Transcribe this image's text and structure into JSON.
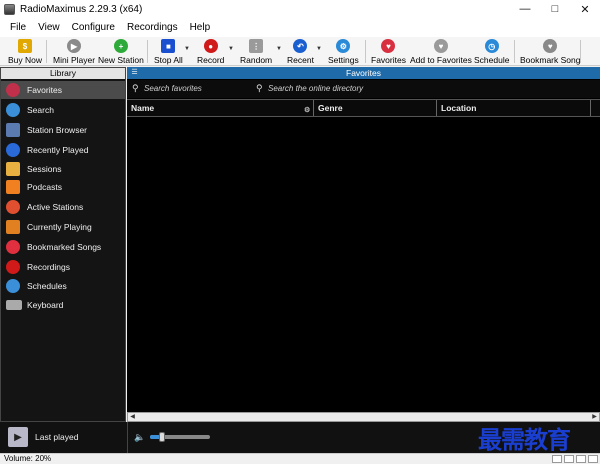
{
  "window": {
    "title": "RadioMaximus 2.29.3 (x64)",
    "controls": [
      "minimize-icon",
      "maximize-icon",
      "close-icon"
    ]
  },
  "menu": [
    "File",
    "View",
    "Configure",
    "Recordings",
    "Help"
  ],
  "toolbar": [
    {
      "id": "buy-now",
      "label": "Buy Now",
      "icon": "buy-now-icon",
      "color": "#e0a800"
    },
    {
      "id": "mini-player",
      "label": "Mini Player",
      "icon": "mini-player-icon",
      "color": "#8a8a8a"
    },
    {
      "id": "new-station",
      "label": "New Station",
      "icon": "plus-icon",
      "color": "#2eaa3a"
    },
    {
      "id": "stop-all",
      "label": "Stop All",
      "icon": "stop-icon",
      "color": "#1a4fd0"
    },
    {
      "id": "record",
      "label": "Record",
      "icon": "record-icon",
      "color": "#d01a1a"
    },
    {
      "id": "random",
      "label": "Random",
      "icon": "dice-icon",
      "color": "#9a9a9a"
    },
    {
      "id": "recent",
      "label": "Recent",
      "icon": "recent-icon",
      "color": "#1a5fd0"
    },
    {
      "id": "settings",
      "label": "Settings",
      "icon": "gear-icon",
      "color": "#2a8ad8"
    },
    {
      "id": "favorites",
      "label": "Favorites",
      "icon": "heart-icon",
      "color": "#d83040"
    },
    {
      "id": "add-to-favorites",
      "label": "Add to Favorites",
      "icon": "heart-add-icon",
      "color": "#9a9a9a"
    },
    {
      "id": "schedule",
      "label": "Schedule",
      "icon": "clock-icon",
      "color": "#2a8ad8"
    },
    {
      "id": "bookmark-song",
      "label": "Bookmark Song",
      "icon": "bookmark-icon",
      "color": "#8a8a8a"
    }
  ],
  "library": {
    "header": "Library",
    "items": [
      {
        "label": "Favorites",
        "icon": "heart-icon",
        "color": "#c0304a",
        "selected": true
      },
      {
        "label": "Search",
        "icon": "search-icon",
        "color": "#3a8fd8"
      },
      {
        "label": "Station Browser",
        "icon": "station-browser-icon",
        "color": "#5a7ab0"
      },
      {
        "label": "Recently Played",
        "icon": "recent-icon",
        "color": "#2a6ad8"
      },
      {
        "label": "Sessions",
        "icon": "folder-icon",
        "color": "#e8b040"
      },
      {
        "label": "Podcasts",
        "icon": "rss-icon",
        "color": "#f08020"
      },
      {
        "label": "Active Stations",
        "icon": "active-stations-icon",
        "color": "#e05030"
      },
      {
        "label": "Currently Playing",
        "icon": "music-note-icon",
        "color": "#e08020"
      },
      {
        "label": "Bookmarked Songs",
        "icon": "heart-icon",
        "color": "#e03040"
      },
      {
        "label": "Recordings",
        "icon": "record-icon",
        "color": "#d01a1a"
      },
      {
        "label": "Schedules",
        "icon": "clock-icon",
        "color": "#3a8fd8"
      },
      {
        "label": "Keyboard",
        "icon": "keyboard-icon",
        "color": "#aaaaaa"
      }
    ]
  },
  "main": {
    "header": "Favorites",
    "search_favorites_placeholder": "Search favorites",
    "search_online_placeholder": "Search the online directory",
    "columns": [
      "Name",
      "Genre",
      "Location"
    ]
  },
  "bottom": {
    "last_played": "Last played"
  },
  "status": {
    "volume": "Volume: 20%",
    "volume_level": 0.2
  },
  "watermark": "最需教育"
}
